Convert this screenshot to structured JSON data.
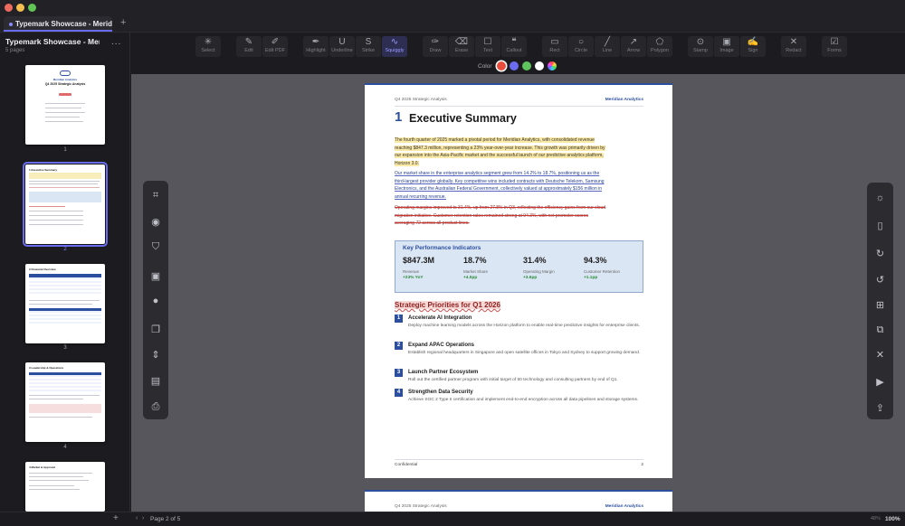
{
  "window": {
    "tab_title": "Typemark Showcase - Meridi...",
    "new_tab": "+"
  },
  "sidebar": {
    "title": "Typemark Showcase - Meri...",
    "subtitle": "5 pages",
    "more": "...",
    "page_numbers": [
      "1",
      "2",
      "3",
      "4"
    ]
  },
  "toolbar": {
    "groups": [
      [
        {
          "label": "Select",
          "icon": "sparkle-icon"
        }
      ],
      [
        {
          "label": "Edit",
          "icon": "pencil-icon"
        },
        {
          "label": "Edit PDF",
          "icon": "edit-box-icon"
        }
      ],
      [
        {
          "label": "Highlight",
          "icon": "highlighter-icon"
        },
        {
          "label": "Underline",
          "icon": "underline-icon"
        },
        {
          "label": "Strike",
          "icon": "strike-icon"
        },
        {
          "label": "Squiggly",
          "icon": "squiggly-icon",
          "active": true
        }
      ],
      [
        {
          "label": "Draw",
          "icon": "pen-icon"
        },
        {
          "label": "Erase",
          "icon": "eraser-icon"
        },
        {
          "label": "Text",
          "icon": "text-box-icon"
        },
        {
          "label": "Callout",
          "icon": "callout-icon"
        }
      ],
      [
        {
          "label": "Rect",
          "icon": "rect-icon"
        },
        {
          "label": "Circle",
          "icon": "circle-icon"
        },
        {
          "label": "Line",
          "icon": "line-icon"
        },
        {
          "label": "Arrow",
          "icon": "arrow-icon"
        },
        {
          "label": "Polygon",
          "icon": "polygon-icon"
        }
      ],
      [
        {
          "label": "Stamp",
          "icon": "stamp-icon"
        },
        {
          "label": "Image",
          "icon": "image-icon"
        },
        {
          "label": "Sign",
          "icon": "signature-icon"
        }
      ],
      [
        {
          "label": "Redact",
          "icon": "redact-icon"
        }
      ],
      [
        {
          "label": "Forms",
          "icon": "forms-icon"
        }
      ]
    ]
  },
  "color_bar": {
    "label": "Color",
    "swatches": [
      "#e74c3c",
      "#6c6cf0",
      "#5ec45e",
      "#ffffff",
      "rainbow"
    ]
  },
  "page": {
    "header_left": "Q4 2025 Strategic Analysis",
    "header_right": "Meridian Analytics",
    "section_number": "1",
    "section_title": "Executive Summary",
    "para1": [
      "The fourth quarter of 2025 marked a pivotal period for Meridian Analytics, with consolidated revenue",
      "reaching $847.3 million, representing a 23% year-over-year increase. This growth was primarily driven by",
      "our expansion into the Asia-Pacific market and the successful launch of our predictive analytics platform,",
      "Horizon 3.0."
    ],
    "para2": [
      "Our market share in the enterprise analytics segment grew from 14.2% to 18.7%, positioning us as the",
      "third-largest provider globally. Key competitive wins included contracts with Deutsche Telekom, Samsung",
      "Electronics, and the Australian Federal Government, collectively valued at approximately $156 million in",
      "annual recurring revenue."
    ],
    "para3": [
      "Operating margins improved to 31.4%, up from 27.8% in Q3, reflecting the efficiency gains from our cloud",
      "migration initiative. Customer retention rates remained strong at 94.3%, with net promoter scores",
      "averaging 72 across all product lines."
    ],
    "kpi": {
      "title": "Key Performance Indicators",
      "items": [
        {
          "value": "$847.3M",
          "label": "Revenue",
          "delta": "+23% YoY"
        },
        {
          "value": "18.7%",
          "label": "Market Share",
          "delta": "+4.5pp"
        },
        {
          "value": "31.4%",
          "label": "Operating Margin",
          "delta": "+3.6pp"
        },
        {
          "value": "94.3%",
          "label": "Customer Retention",
          "delta": "+1.1pp"
        }
      ]
    },
    "priorities_title": "Strategic Priorities for Q1 2026",
    "priorities": [
      {
        "n": "1",
        "title": "Accelerate AI Integration",
        "desc": "Deploy machine learning models across the Horizon platform to enable real-time predictive insights for enterprise clients."
      },
      {
        "n": "2",
        "title": "Expand APAC Operations",
        "desc": "Establish regional headquarters in Singapore and open satellite offices in Tokyo and Sydney to support growing demand."
      },
      {
        "n": "3",
        "title": "Launch Partner Ecosystem",
        "desc": "Roll out the certified partner program with initial target of 50 technology and consulting partners by end of Q1."
      },
      {
        "n": "4",
        "title": "Strengthen Data Security",
        "desc": "Achieve SOC 2 Type II certification and implement end-to-end encryption across all data pipelines and storage systems."
      }
    ],
    "footer_left": "Confidential",
    "footer_right": "2"
  },
  "page2": {
    "header_left": "Q4 2025 Strategic Analysis",
    "header_right": "Meridian Analytics"
  },
  "footer": {
    "add": "+",
    "page_indicator": "Page 2 of 5",
    "zoom_small": "48%",
    "zoom": "100%"
  },
  "thumb1": {
    "brand": "Meridian Analytics",
    "title": "Q4 2025 Strategic Analysis"
  },
  "thumb_titles": {
    "p2": "1  Executive Summary",
    "p3": "2  Financial Overview",
    "p4": "3  Leadership & Operations",
    "p5": "4  Market & Approval"
  }
}
